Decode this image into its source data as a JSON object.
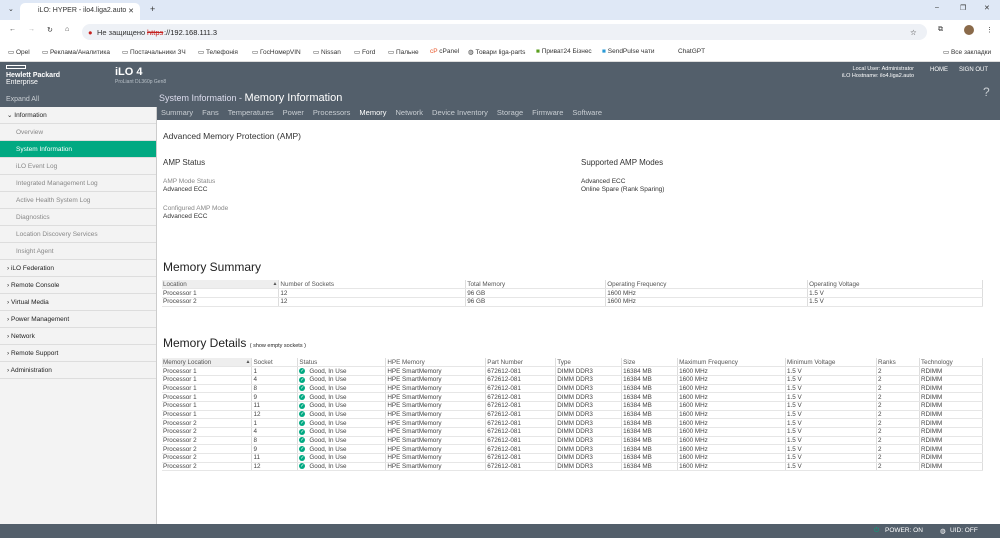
{
  "browser": {
    "tab_title": "iLO: HYPER - ilo4.liga2.auto",
    "security": "Не защищено",
    "url_scheme": "https",
    "url_rest": "://192.168.111.3",
    "bookmarks": [
      "Opel",
      "Реклама/Аналитика",
      "Постачальники ЗЧ",
      "Телефонія",
      "ГосНомерVIN",
      "Nissan",
      "Ford",
      "Пальне",
      "cPanel",
      "Товари liga-parts",
      "Приват24 Бізнес",
      "SendPulse чати",
      "ChatGPT"
    ],
    "all_bookmarks": "Все закладки"
  },
  "header": {
    "brand1": "Hewlett Packard",
    "brand2": "Enterprise",
    "product": "iLO 4",
    "server": "ProLiant DL360p Gen8",
    "user": "Local User: Administrator",
    "hostname": "iLO Hostname: ilo4.liga2.auto",
    "home": "HOME",
    "signout": "SIGN OUT",
    "help": "?",
    "crumb": "System Information - ",
    "title": "Memory Information",
    "expand_all": "Expand All",
    "tabs": [
      "Summary",
      "Fans",
      "Temperatures",
      "Power",
      "Processors",
      "Memory",
      "Network",
      "Device Inventory",
      "Storage",
      "Firmware",
      "Software"
    ]
  },
  "sidebar": [
    {
      "label": "Information",
      "type": "group",
      "open": true
    },
    {
      "label": "Overview",
      "type": "sub"
    },
    {
      "label": "System Information",
      "type": "sub",
      "active": true
    },
    {
      "label": "iLO Event Log",
      "type": "sub"
    },
    {
      "label": "Integrated Management Log",
      "type": "sub"
    },
    {
      "label": "Active Health System Log",
      "type": "sub"
    },
    {
      "label": "Diagnostics",
      "type": "sub"
    },
    {
      "label": "Location Discovery Services",
      "type": "sub"
    },
    {
      "label": "Insight Agent",
      "type": "sub"
    },
    {
      "label": "iLO Federation",
      "type": "group"
    },
    {
      "label": "Remote Console",
      "type": "group"
    },
    {
      "label": "Virtual Media",
      "type": "group"
    },
    {
      "label": "Power Management",
      "type": "group"
    },
    {
      "label": "Network",
      "type": "group"
    },
    {
      "label": "Remote Support",
      "type": "group"
    },
    {
      "label": "Administration",
      "type": "group"
    }
  ],
  "amp": {
    "title": "Advanced Memory Protection (AMP)",
    "status_title": "AMP Status",
    "mode_status_label": "AMP Mode Status",
    "mode_status": "Advanced ECC",
    "configured_label": "Configured AMP Mode",
    "configured": "Advanced ECC",
    "supported_title": "Supported AMP Modes",
    "supported": [
      "Advanced ECC",
      "Online Spare (Rank Sparing)"
    ]
  },
  "summary": {
    "title": "Memory Summary",
    "headers": [
      "Location",
      "Number of Sockets",
      "Total Memory",
      "Operating Frequency",
      "Operating Voltage"
    ],
    "rows": [
      [
        "Processor 1",
        "12",
        "96 GB",
        "1600 MHz",
        "1.5 V"
      ],
      [
        "Processor 2",
        "12",
        "96 GB",
        "1600 MHz",
        "1.5 V"
      ]
    ]
  },
  "details": {
    "title": "Memory Details",
    "show_empty": "( show empty sockets )",
    "headers": [
      "Memory Location",
      "Socket",
      "Status",
      "HPE Memory",
      "Part Number",
      "Type",
      "Size",
      "Maximum Frequency",
      "Minimum Voltage",
      "Ranks",
      "Technology"
    ],
    "rows": [
      [
        "Processor 1",
        "1",
        "Good, In Use",
        "HPE SmartMemory",
        "672612-081",
        "DIMM DDR3",
        "16384 MB",
        "1600 MHz",
        "1.5 V",
        "2",
        "RDIMM"
      ],
      [
        "Processor 1",
        "4",
        "Good, In Use",
        "HPE SmartMemory",
        "672612-081",
        "DIMM DDR3",
        "16384 MB",
        "1600 MHz",
        "1.5 V",
        "2",
        "RDIMM"
      ],
      [
        "Processor 1",
        "8",
        "Good, In Use",
        "HPE SmartMemory",
        "672612-081",
        "DIMM DDR3",
        "16384 MB",
        "1600 MHz",
        "1.5 V",
        "2",
        "RDIMM"
      ],
      [
        "Processor 1",
        "9",
        "Good, In Use",
        "HPE SmartMemory",
        "672612-081",
        "DIMM DDR3",
        "16384 MB",
        "1600 MHz",
        "1.5 V",
        "2",
        "RDIMM"
      ],
      [
        "Processor 1",
        "11",
        "Good, In Use",
        "HPE SmartMemory",
        "672612-081",
        "DIMM DDR3",
        "16384 MB",
        "1600 MHz",
        "1.5 V",
        "2",
        "RDIMM"
      ],
      [
        "Processor 1",
        "12",
        "Good, In Use",
        "HPE SmartMemory",
        "672612-081",
        "DIMM DDR3",
        "16384 MB",
        "1600 MHz",
        "1.5 V",
        "2",
        "RDIMM"
      ],
      [
        "Processor 2",
        "1",
        "Good, In Use",
        "HPE SmartMemory",
        "672612-081",
        "DIMM DDR3",
        "16384 MB",
        "1600 MHz",
        "1.5 V",
        "2",
        "RDIMM"
      ],
      [
        "Processor 2",
        "4",
        "Good, In Use",
        "HPE SmartMemory",
        "672612-081",
        "DIMM DDR3",
        "16384 MB",
        "1600 MHz",
        "1.5 V",
        "2",
        "RDIMM"
      ],
      [
        "Processor 2",
        "8",
        "Good, In Use",
        "HPE SmartMemory",
        "672612-081",
        "DIMM DDR3",
        "16384 MB",
        "1600 MHz",
        "1.5 V",
        "2",
        "RDIMM"
      ],
      [
        "Processor 2",
        "9",
        "Good, In Use",
        "HPE SmartMemory",
        "672612-081",
        "DIMM DDR3",
        "16384 MB",
        "1600 MHz",
        "1.5 V",
        "2",
        "RDIMM"
      ],
      [
        "Processor 2",
        "11",
        "Good, In Use",
        "HPE SmartMemory",
        "672612-081",
        "DIMM DDR3",
        "16384 MB",
        "1600 MHz",
        "1.5 V",
        "2",
        "RDIMM"
      ],
      [
        "Processor 2",
        "12",
        "Good, In Use",
        "HPE SmartMemory",
        "672612-081",
        "DIMM DDR3",
        "16384 MB",
        "1600 MHz",
        "1.5 V",
        "2",
        "RDIMM"
      ]
    ]
  },
  "footer": {
    "power": "POWER: ON",
    "uid": "UID: OFF"
  },
  "colors": {
    "accent": "#01a982",
    "header": "#535f6b"
  }
}
